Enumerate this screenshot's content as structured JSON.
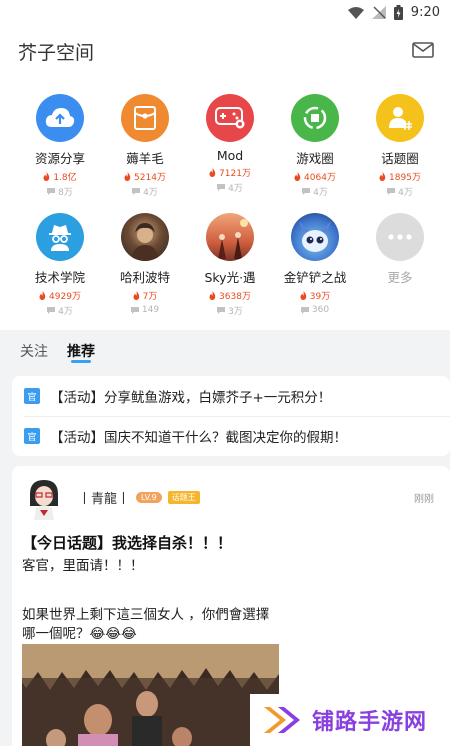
{
  "status_bar": {
    "time": "9:20"
  },
  "header": {
    "title": "芥子空间",
    "mail_icon": "mail-icon"
  },
  "grid": [
    {
      "label": "资源分享",
      "heat": "1.8亿",
      "comments": "8万",
      "icon": "cloud-upload-icon",
      "color": "#3b8ef0"
    },
    {
      "label": "薅羊毛",
      "heat": "5214万",
      "comments": "4万",
      "icon": "red-envelope-icon",
      "color": "#f08a30"
    },
    {
      "label": "Mod",
      "heat": "7121万",
      "comments": "4万",
      "icon": "gamepad-icon",
      "color": "#e8474a"
    },
    {
      "label": "游戏圈",
      "heat": "4064万",
      "comments": "4万",
      "icon": "orbit-icon",
      "color": "#48b648"
    },
    {
      "label": "话题圈",
      "heat": "1895万",
      "comments": "4万",
      "icon": "user-hash-icon",
      "color": "#f5c11b"
    },
    {
      "label": "技术学院",
      "heat": "4929万",
      "comments": "4万",
      "icon": "spy-icon",
      "color": "#2c9fe0"
    },
    {
      "label": "哈利波特",
      "heat": "7万",
      "comments": "149",
      "icon": "harry-potter-avatar-icon",
      "color": "#5a4a3a"
    },
    {
      "label": "Sky光·遇",
      "heat": "3638万",
      "comments": "3万",
      "icon": "sky-avatar-icon",
      "color": "#c7553f"
    },
    {
      "label": "金铲铲之战",
      "heat": "39万",
      "comments": "360",
      "icon": "tft-avatar-icon",
      "color": "#3c73c9"
    },
    {
      "label": "更多",
      "heat": "",
      "comments": "",
      "icon": "more-dots-icon",
      "color": "#dcdcdc"
    }
  ],
  "tabs": [
    {
      "label": "关注"
    },
    {
      "label": "推荐"
    }
  ],
  "notices": [
    {
      "tag": "官",
      "text": "【活动】分享鱿鱼游戏，白嫖芥子+一元积分！"
    },
    {
      "tag": "官",
      "text": "【活动】国庆不知道干什么？截图决定你的假期！"
    }
  ],
  "post": {
    "author": "丨青龍丨",
    "level": "LV.9",
    "role": "话题王",
    "time": "刚刚",
    "title": "【今日话题】我选择自杀！！！",
    "lines": [
      "客官，里面请！！！",
      "如果世界上剩下這三個女人 ，你們會選擇",
      "哪一個呢？😂😂😂"
    ]
  },
  "watermark": {
    "text": "铺路手游网"
  }
}
